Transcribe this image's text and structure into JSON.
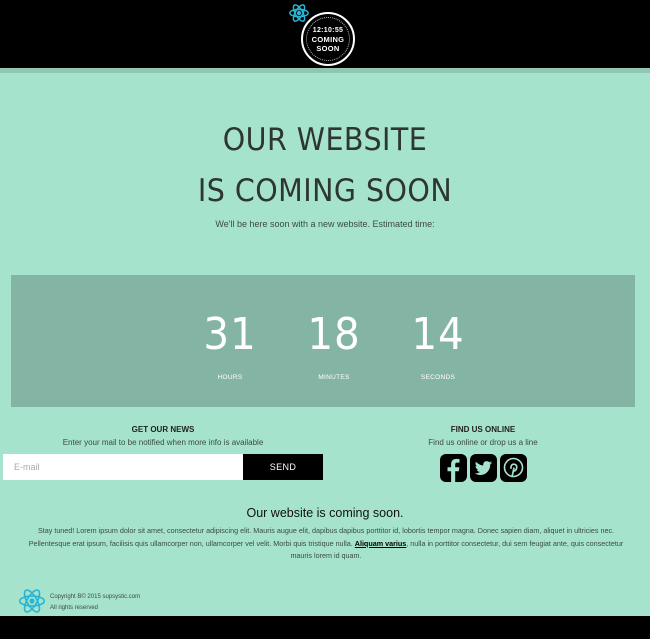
{
  "header": {
    "clock_time": "12:10:55",
    "clock_line1": "COMING",
    "clock_line2": "SOON"
  },
  "hero": {
    "title_line1": "OUR WEBSITE",
    "title_line2": "IS COMING SOON",
    "subtitle": "We'll be here soon with a new website. Estimated time:"
  },
  "countdown": {
    "hours_value": "31",
    "hours_label": "HOURS",
    "minutes_value": "18",
    "minutes_label": "MINUTES",
    "seconds_value": "14",
    "seconds_label": "SECONDS"
  },
  "newsletter": {
    "title": "GET OUR NEWS",
    "subtitle": "Enter your mail to be notified when more info is available",
    "email_placeholder": "E-mail",
    "send_label": "SEND"
  },
  "social": {
    "title": "FIND US ONLINE",
    "subtitle": "Find us online or drop us a line",
    "icons": [
      "facebook-icon",
      "twitter-icon",
      "pinterest-icon"
    ]
  },
  "about": {
    "title": "Our website is coming soon.",
    "text_before": "Stay tuned! Lorem ipsum dolor sit amet, consectetur adipiscing elit. Mauris augue elit, dapibus dapibus porttitor id, lobortis tempor magna. Donec sapien diam, aliquet in ultricies nec. Pellentesque erat ipsum, facilisis quis ullamcorper non, ullamcorper vel velit. Morbi quis tristique nulla. ",
    "text_bold": "Aliquam varius",
    "text_after": ", nulla in porttitor consectetur, dui sem feugiat ante, quis consectetur mauris lorem id quam."
  },
  "footer": {
    "copyright": "Copyright B© 2015 supsystic.com",
    "rights": "All rights reserved"
  },
  "colors": {
    "background": "#a6e3cd",
    "panel": "#84b5a4",
    "bar": "#000000",
    "logo_accent": "#29b6d6"
  }
}
